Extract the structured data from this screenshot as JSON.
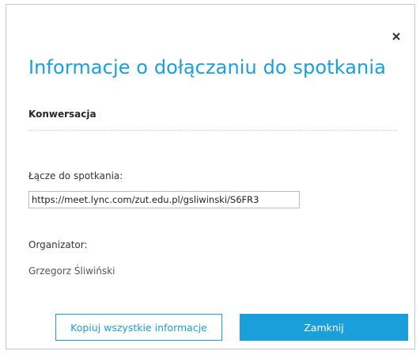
{
  "dialog": {
    "title": "Informacje o dołączaniu do spotkania",
    "section_title": "Konwersacja",
    "close_icon": "close-icon"
  },
  "meeting": {
    "link_label": "Łącze do spotkania:",
    "link_value": "https://meet.lync.com/zut.edu.pl/gsliwinski/S6FR3",
    "organizer_label": "Organizator:",
    "organizer_name": "Grzegorz Śliwiński"
  },
  "buttons": {
    "copy_label": "Kopiuj wszystkie informacje",
    "close_label": "Zamknij"
  },
  "colors": {
    "accent": "#1a9fdb",
    "text": "#262626",
    "border": "#c8c8c8"
  }
}
